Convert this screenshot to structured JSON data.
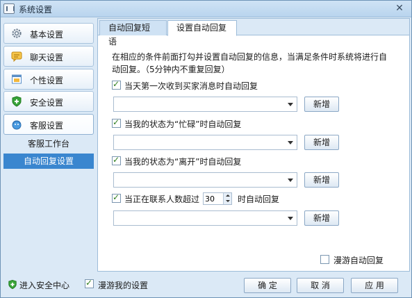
{
  "window": {
    "title": "系统设置",
    "close_glyph": "✕"
  },
  "sidebar": {
    "items": [
      {
        "label": "基本设置",
        "icon": "gear-icon"
      },
      {
        "label": "聊天设置",
        "icon": "chat-icon"
      },
      {
        "label": "个性设置",
        "icon": "window-icon"
      },
      {
        "label": "安全设置",
        "icon": "shield-icon"
      },
      {
        "label": "客服设置",
        "icon": "customer-service-icon"
      }
    ],
    "sub_items": [
      {
        "label": "客服工作台"
      },
      {
        "label": "自动回复设置"
      }
    ]
  },
  "tabs": [
    {
      "label": "自动回复短语"
    },
    {
      "label": "设置自动回复"
    }
  ],
  "content": {
    "description": "在相应的条件前面打勾并设置自动回复的信息，当满足条件时系统将进行自动回复。（5分钟内不重复回复）",
    "rules": [
      {
        "label": "当天第一次收到买家消息时自动回复",
        "checked": true
      },
      {
        "label": "当我的状态为“忙碌”时自动回复",
        "checked": true
      },
      {
        "label": "当我的状态为“离开”时自动回复",
        "checked": true
      }
    ],
    "contacts_rule": {
      "prefix": "当正在联系人数超过",
      "value": "30",
      "suffix": "时自动回复",
      "checked": true
    },
    "add_label": "新增",
    "roaming_reply": {
      "label": "漫游自动回复",
      "checked": false
    }
  },
  "footer": {
    "security_center": "进入安全中心",
    "roaming_settings": {
      "label": "漫游我的设置",
      "checked": true
    },
    "buttons": {
      "ok": "确 定",
      "cancel": "取 消",
      "apply": "应 用"
    }
  }
}
